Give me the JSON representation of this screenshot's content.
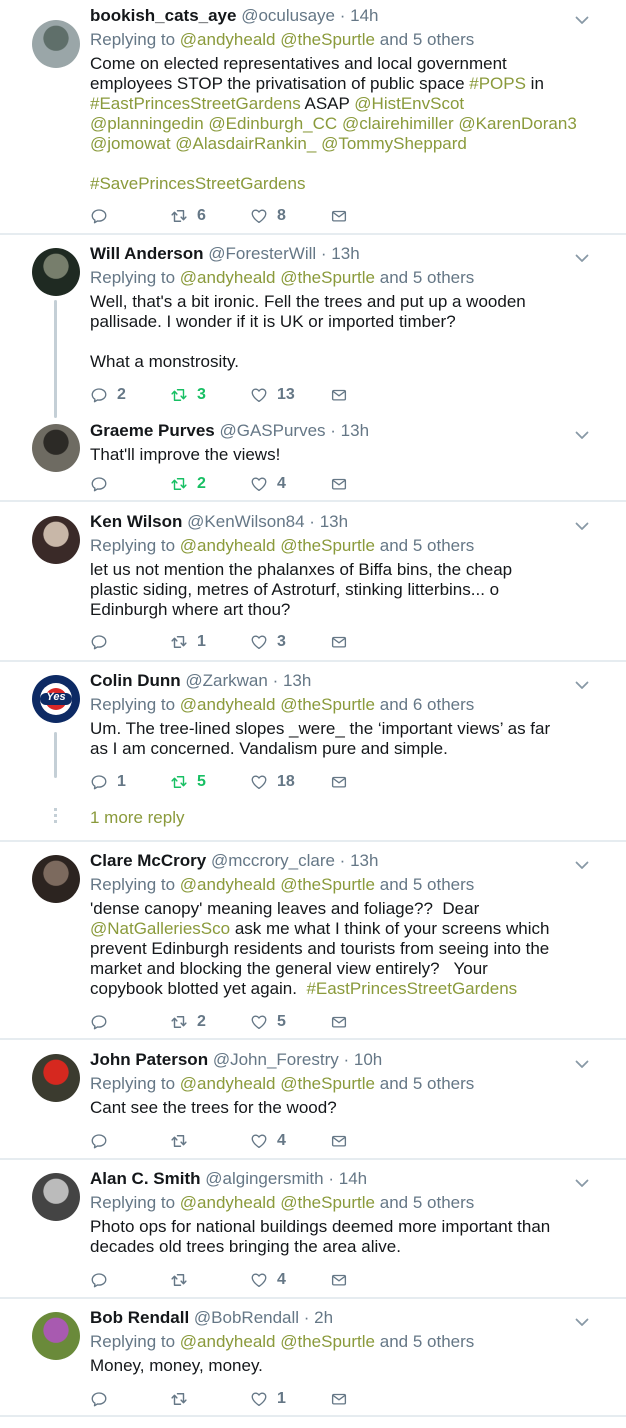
{
  "tweets": [
    {
      "name": "bookish_cats_aye",
      "handle": "@oculusaye",
      "time": "14h",
      "reply_to": [
        "@andyheald",
        "@theSpurtle"
      ],
      "reply_others": "5 others",
      "lines": [
        [
          {
            "t": "Come on elected representatives and local government"
          }
        ],
        [
          {
            "t": "employees STOP the privatisation of public space "
          },
          {
            "t": "#POPS",
            "c": "hashtag"
          },
          {
            "t": " in"
          }
        ],
        [
          {
            "t": "#EastPrincesStreetGardens",
            "c": "hashtag"
          },
          {
            "t": " ASAP "
          },
          {
            "t": "@HistEnvScot",
            "c": "mention"
          }
        ],
        [
          {
            "t": "@planningedin",
            "c": "mention"
          },
          {
            "t": " "
          },
          {
            "t": "@Edinburgh_CC",
            "c": "mention"
          },
          {
            "t": " "
          },
          {
            "t": "@clairehimiller",
            "c": "mention"
          },
          {
            "t": " "
          },
          {
            "t": "@KarenDoran3",
            "c": "mention"
          }
        ],
        [
          {
            "t": "@jomowat",
            "c": "mention"
          },
          {
            "t": " "
          },
          {
            "t": "@AlasdairRankin_",
            "c": "mention"
          },
          {
            "t": " "
          },
          {
            "t": "@TommySheppard",
            "c": "mention"
          }
        ],
        [],
        [
          {
            "t": "#SavePrincesStreetGardens",
            "c": "hashtag"
          }
        ]
      ],
      "replies": "",
      "retweets": "6",
      "likes": "8",
      "retweeted": false
    },
    {
      "name": "Will Anderson",
      "handle": "@ForesterWill",
      "time": "13h",
      "reply_to": [
        "@andyheald",
        "@theSpurtle"
      ],
      "reply_others": "5 others",
      "lines": [
        [
          {
            "t": "Well, that's a bit ironic. Fell the trees and put up a wooden"
          }
        ],
        [
          {
            "t": "pallisade. I wonder if it is UK or imported timber?"
          }
        ],
        [],
        [
          {
            "t": "What a monstrosity."
          }
        ]
      ],
      "replies": "2",
      "retweets": "3",
      "likes": "13",
      "retweeted": true
    },
    {
      "name": "Graeme Purves",
      "handle": "@GASPurves",
      "time": "13h",
      "reply_to": [],
      "reply_others": "",
      "lines": [
        [
          {
            "t": "That'll improve the views!"
          }
        ]
      ],
      "replies": "",
      "retweets": "2",
      "likes": "4",
      "retweeted": true
    },
    {
      "name": "Ken Wilson",
      "handle": "@KenWilson84",
      "time": "13h",
      "reply_to": [
        "@andyheald",
        "@theSpurtle"
      ],
      "reply_others": "5 others",
      "lines": [
        [
          {
            "t": "let us not mention the phalanxes of Biffa bins, the cheap"
          }
        ],
        [
          {
            "t": "plastic siding, metres of Astroturf, stinking litterbins... o"
          }
        ],
        [
          {
            "t": "Edinburgh where art thou?"
          }
        ]
      ],
      "replies": "",
      "retweets": "1",
      "likes": "3",
      "retweeted": false
    },
    {
      "name": "Colin Dunn",
      "handle": "@Zarkwan",
      "time": "13h",
      "reply_to": [
        "@andyheald",
        "@theSpurtle"
      ],
      "reply_others": "6 others",
      "lines": [
        [
          {
            "t": "Um. The tree-lined slopes _were_ the ‘important views’ as far"
          }
        ],
        [
          {
            "t": "as I am concerned. Vandalism pure and simple."
          }
        ]
      ],
      "replies": "1",
      "retweets": "5",
      "likes": "18",
      "retweeted": true,
      "avatar_text": "Yes"
    },
    {
      "name": "Clare McCrory",
      "handle": "@mccrory_clare",
      "time": "13h",
      "reply_to": [
        "@andyheald",
        "@theSpurtle"
      ],
      "reply_others": "5 others",
      "lines": [
        [
          {
            "t": "'dense canopy' meaning leaves and foliage??  Dear"
          }
        ],
        [
          {
            "t": "@NatGalleriesSco",
            "c": "mention"
          },
          {
            "t": " ask me what I think of your screens which"
          }
        ],
        [
          {
            "t": "prevent Edinburgh residents and tourists from seeing into the"
          }
        ],
        [
          {
            "t": "market and blocking the general view entirely?   Your"
          }
        ],
        [
          {
            "t": "copybook blotted yet again.  "
          },
          {
            "t": "#EastPrincesStreetGardens",
            "c": "hashtag"
          }
        ]
      ],
      "replies": "",
      "retweets": "2",
      "likes": "5",
      "retweeted": false
    },
    {
      "name": "John Paterson",
      "handle": "@John_Forestry",
      "time": "10h",
      "reply_to": [
        "@andyheald",
        "@theSpurtle"
      ],
      "reply_others": "5 others",
      "lines": [
        [
          {
            "t": "Cant see the trees for the wood?"
          }
        ]
      ],
      "replies": "",
      "retweets": "",
      "likes": "4",
      "retweeted": false
    },
    {
      "name": "Alan C. Smith",
      "handle": "@algingersmith",
      "time": "14h",
      "reply_to": [
        "@andyheald",
        "@theSpurtle"
      ],
      "reply_others": "5 others",
      "lines": [
        [
          {
            "t": "Photo ops for national buildings deemed more important than"
          }
        ],
        [
          {
            "t": "decades old trees bringing the area alive."
          }
        ]
      ],
      "replies": "",
      "retweets": "",
      "likes": "4",
      "retweeted": false
    },
    {
      "name": "Bob Rendall",
      "handle": "@BobRendall",
      "time": "2h",
      "reply_to": [
        "@andyheald",
        "@theSpurtle"
      ],
      "reply_others": "5 others",
      "lines": [
        [
          {
            "t": "Money, money, money."
          }
        ]
      ],
      "replies": "",
      "retweets": "",
      "likes": "1",
      "retweeted": false
    }
  ],
  "labels": {
    "replying_to": "Replying to",
    "and": "and",
    "more_reply": "1 more reply",
    "separator": " · "
  },
  "colors": {
    "link": "#8a9a3b",
    "retweet_active": "#17bf63",
    "muted": "#657786"
  },
  "icons": {
    "reply": "reply-icon",
    "retweet": "retweet-icon",
    "like": "heart-icon",
    "dm": "envelope-icon",
    "menu": "chevron-down-icon"
  }
}
